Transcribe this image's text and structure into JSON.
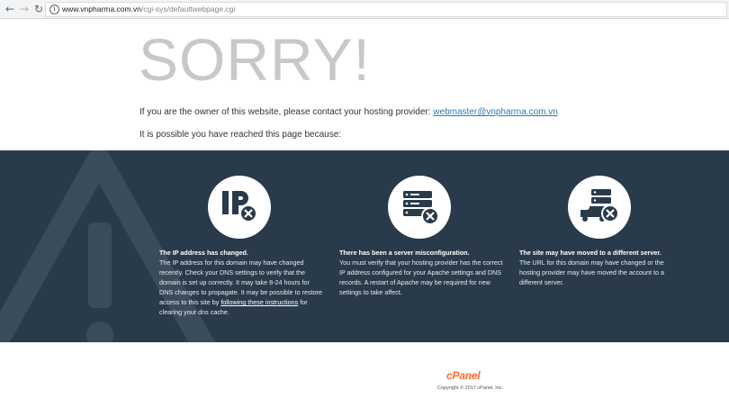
{
  "browser": {
    "url_host": "www.vnpharma.com.vn",
    "url_path": "/cgi-sys/defaultwebpage.cgi"
  },
  "headline": "SORRY!",
  "owner_text": "If you are the owner of this website, please contact your hosting provider: ",
  "owner_email": "webmaster@vnpharma.com.vn",
  "reason_intro": "It is possible you have reached this page because:",
  "reasons": [
    {
      "icon": "ip-address-error-icon",
      "title": "The IP address has changed.",
      "text": "The IP address for this domain may have changed recently. Check your DNS settings to verify that the domain is set up correctly. It may take 8-24 hours for DNS changes to propagate. It may be possible to restore access to this site by ",
      "link": "following these instructions",
      "text_after": " for clearing your dns cache."
    },
    {
      "icon": "server-misconfiguration-icon",
      "title": "There has been a server misconfiguration.",
      "text": "You must verify that your hosting provider has the correct IP address configured for your Apache settings and DNS records. A restart of Apache may be required for new settings to take affect."
    },
    {
      "icon": "server-moved-icon",
      "title": "The site may have moved to a different server.",
      "text": "The URL for this domain may have changed or the hosting provider may have moved the account to a different server."
    }
  ],
  "footer": {
    "logo": "cPanel",
    "copyright": "Copyright © 2017 cPanel, Inc."
  },
  "colors": {
    "band": "#293a4a",
    "headline": "#c8c8c8",
    "link": "#2a7ab0",
    "cpanel_orange": "#ff6c2c"
  }
}
